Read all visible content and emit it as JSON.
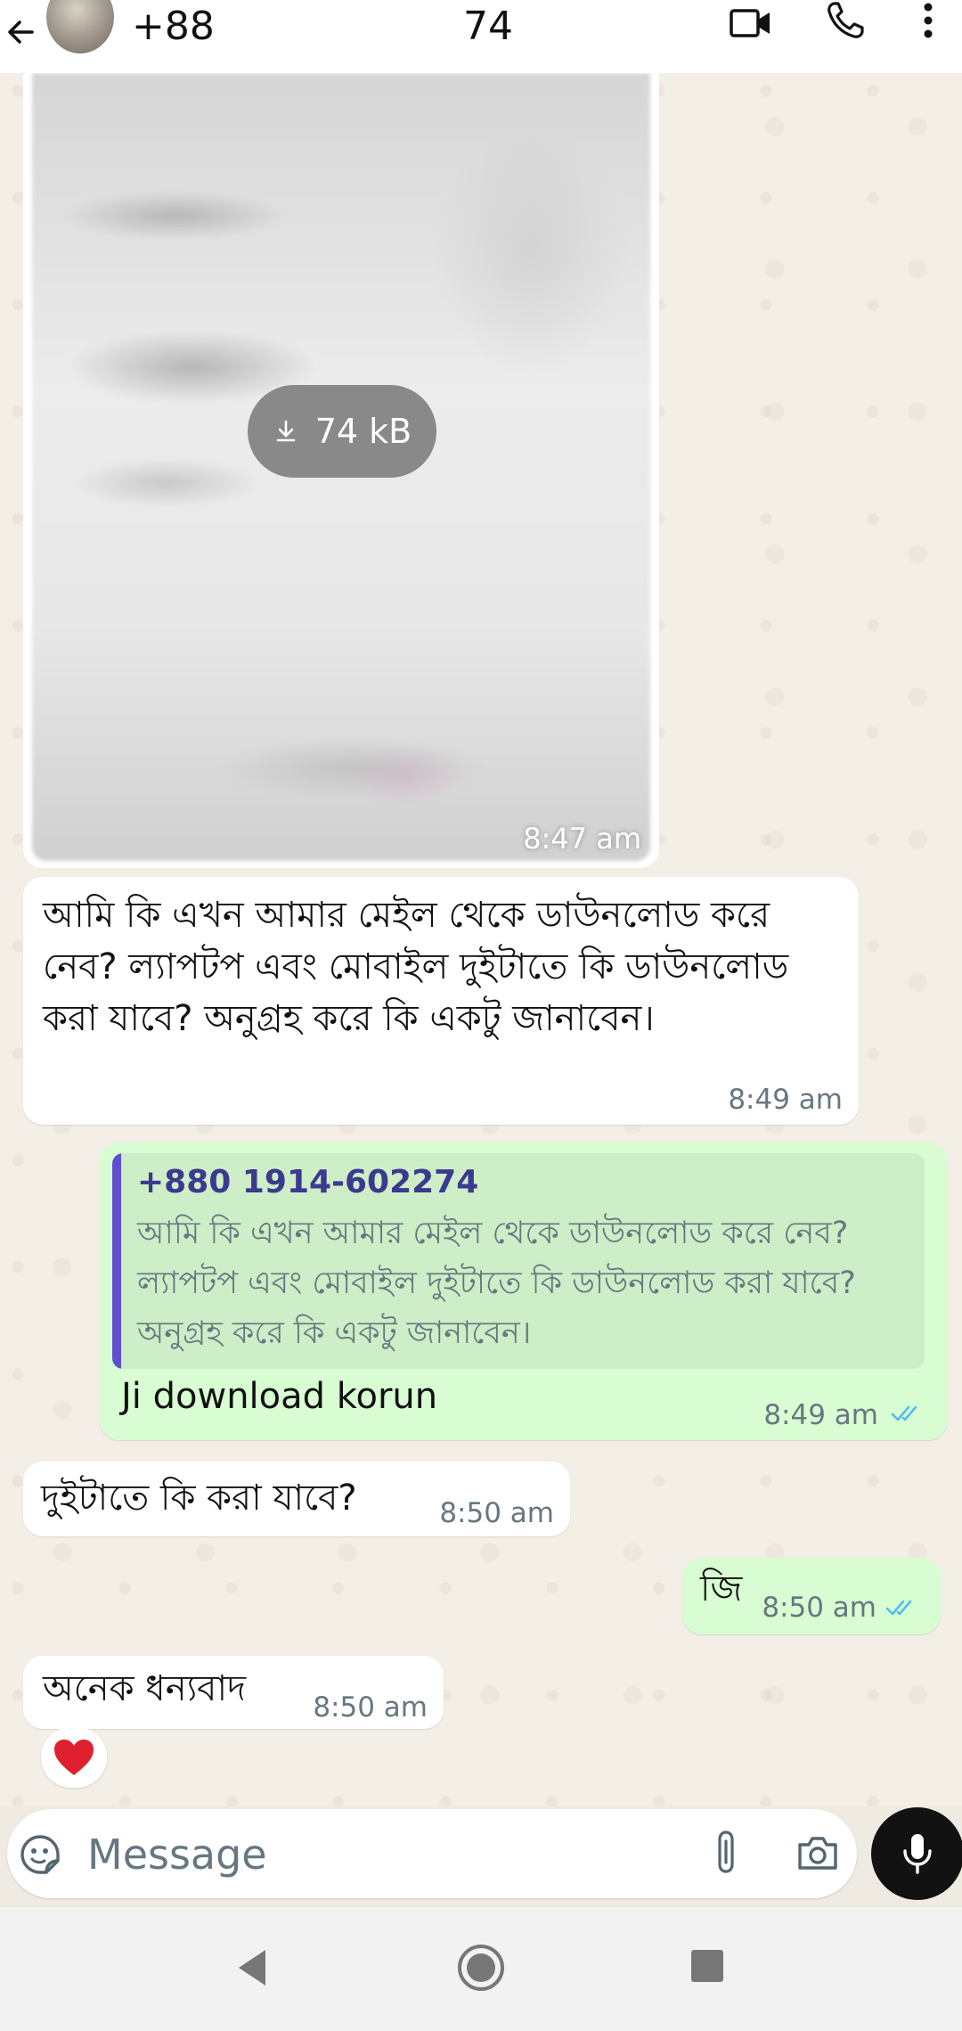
{
  "header": {
    "contact_prefix": "+88",
    "contact_suffix": "74"
  },
  "media": {
    "size_label": "74 kB",
    "time": "8:47 am"
  },
  "messages": [
    {
      "direction": "in",
      "text": "আমি কি এখন আমার মেইল থেকে ডাউনলোড করে নেব? ল্যাপটপ এবং মোবাইল দুইটাতে কি ডাউনলোড করা যাবে? অনুগ্রহ করে কি একটু জানাবেন।",
      "time": "8:49 am"
    },
    {
      "direction": "out",
      "quote_author": "+880 1914-602274",
      "quote_text": "আমি কি এখন আমার মেইল থেকে ডাউনলোড করে নেব? ল্যাপটপ এবং মোবাইল দুইটাতে কি ডাউনলোড করা যাবে? অনুগ্রহ করে কি একটু জানাবেন।",
      "text": "Ji download korun",
      "time": "8:49 am",
      "status": "read"
    },
    {
      "direction": "in",
      "text": "দুইটাতে কি করা যাবে?",
      "time": "8:50 am"
    },
    {
      "direction": "out",
      "text": "জি",
      "time": "8:50 am",
      "status": "read"
    },
    {
      "direction": "in",
      "text": "অনেক ধন্যবাদ",
      "time": "8:50 am",
      "reaction": "❤️"
    }
  ],
  "composer": {
    "placeholder": "Message"
  },
  "colors": {
    "outgoing_bubble": "#d9fdd3",
    "incoming_bubble": "#ffffff",
    "read_ticks": "#53bdeb",
    "quote_bar": "#5d4fd0"
  }
}
